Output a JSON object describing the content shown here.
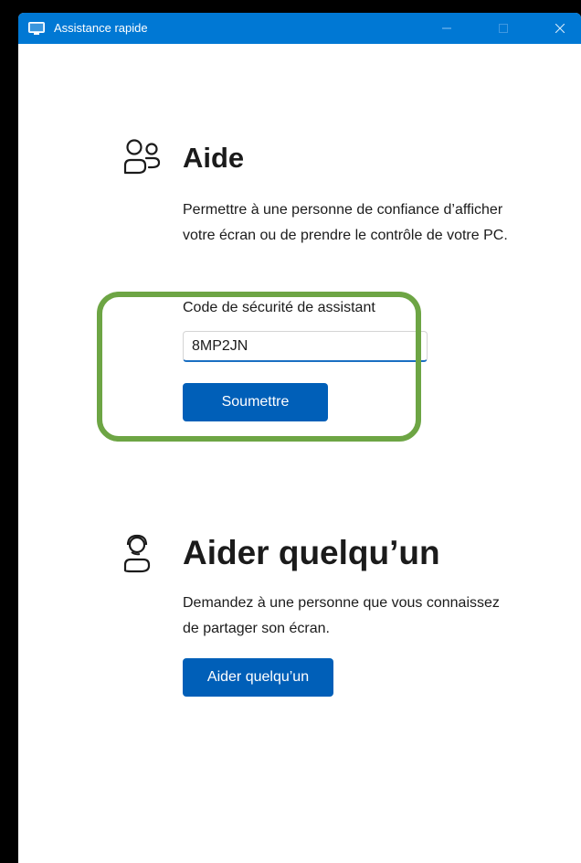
{
  "window": {
    "title": "Assistance rapide",
    "controls": [
      "minimize-icon",
      "maximize-icon",
      "close-icon"
    ],
    "accent_color": "#0078d4"
  },
  "help": {
    "icon": "people-icon",
    "heading": "Aide",
    "description": "Permettre à une personne de confiance d’afficher votre écran ou de prendre le contrôle de votre PC.",
    "code_label": "Code de sécurité de assistant",
    "code_value": "8MP2JN",
    "submit_label": "Soumettre"
  },
  "assist": {
    "icon": "headset-person-icon",
    "heading": "Aider quelqu’un",
    "description": "Demandez à une personne que vous connaissez de partager son écran.",
    "button_label": "Aider quelqu’un"
  },
  "annotation": {
    "highlight_color": "#6da544"
  }
}
